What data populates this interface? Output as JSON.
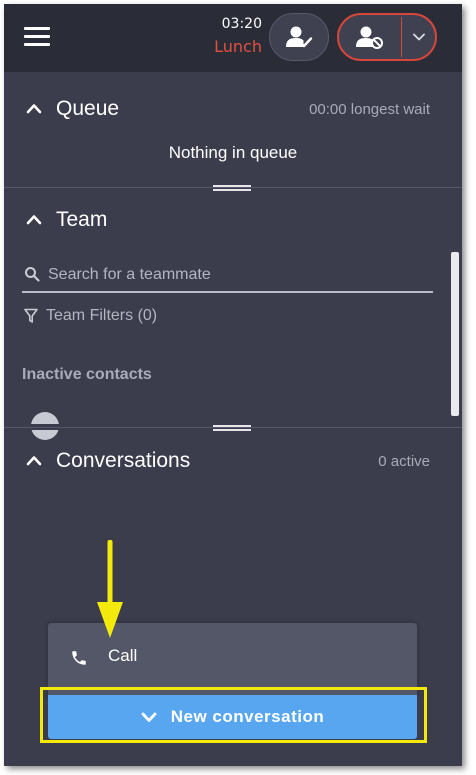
{
  "topbar": {
    "timer": "03:20",
    "status": "Lunch",
    "icons": {
      "menu": "hamburger-menu-icon",
      "available": "user-check-icon",
      "unavailable": "user-blocked-icon",
      "dropdown": "chevron-down-icon"
    }
  },
  "queue": {
    "title": "Queue",
    "longest_wait": "00:00 longest wait",
    "empty_text": "Nothing in queue"
  },
  "team": {
    "title": "Team",
    "search_placeholder": "Search for a teammate",
    "filters_label": "Team Filters (0)",
    "group_label": "Inactive contacts"
  },
  "conversations": {
    "title": "Conversations",
    "active_count": "0 active"
  },
  "new_conversation_menu": {
    "items": [
      {
        "label": "Call",
        "icon": "phone-icon"
      }
    ],
    "button_label": "New conversation"
  },
  "colors": {
    "panel_bg": "#3b3d4c",
    "topbar_bg": "#2a2c38",
    "status_red": "#e2503f",
    "button_blue": "#58a6f0",
    "annotation_yellow": "#f3ea0b"
  }
}
